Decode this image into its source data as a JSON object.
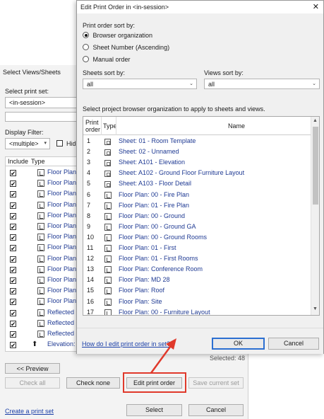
{
  "bg": {
    "title": "Select Views/Sheets",
    "select_print_set_label": "Select print set:",
    "print_set_value": "<in-session>",
    "display_filter_label": "Display Filter:",
    "display_filter_value": "<multiple>",
    "hide_label": "Hid",
    "col_include": "Include",
    "col_type": "Type",
    "rows": [
      {
        "label": "Floor Plan:"
      },
      {
        "label": "Floor Plan:"
      },
      {
        "label": "Floor Plan:"
      },
      {
        "label": "Floor Plan:"
      },
      {
        "label": "Floor Plan:"
      },
      {
        "label": "Floor Plan:"
      },
      {
        "label": "Floor Plan:"
      },
      {
        "label": "Floor Plan:"
      },
      {
        "label": "Floor Plan:"
      },
      {
        "label": "Floor Plan:"
      },
      {
        "label": "Floor Plan:"
      },
      {
        "label": "Floor Plan:"
      },
      {
        "label": "Floor Plan:"
      },
      {
        "label": "Reflected C"
      },
      {
        "label": "Reflected C"
      },
      {
        "label": "Reflected C"
      },
      {
        "label": "Elevation: E"
      }
    ],
    "selected_count": "Selected: 48",
    "preview_btn": "<< Preview",
    "check_all_btn": "Check all",
    "check_none_btn": "Check none",
    "edit_print_order_btn": "Edit print order",
    "save_current_set_btn": "Save current set",
    "create_print_set_link": "Create a print set",
    "select_btn": "Select",
    "cancel_btn": "Cancel"
  },
  "dialog": {
    "title": "Edit Print Order in <in-session>",
    "close_glyph": "✕",
    "sort_by_label": "Print order sort by:",
    "radio_browser": "Browser organization",
    "radio_sheet_number": "Sheet Number (Ascending)",
    "radio_manual": "Manual order",
    "sheets_sort_label": "Sheets sort by:",
    "sheets_sort_value": "all",
    "views_sort_label": "Views sort by:",
    "views_sort_value": "all",
    "instructions": "Select project browser organization to apply to sheets and views.",
    "col_print_order_1": "Print",
    "col_print_order_2": "order",
    "col_type": "Type",
    "col_name": "Name",
    "rows": [
      {
        "n": "1",
        "kind": "sheet",
        "name": "Sheet: 01 - Room Template"
      },
      {
        "n": "2",
        "kind": "sheet",
        "name": "Sheet: 02 - Unnamed"
      },
      {
        "n": "3",
        "kind": "sheet",
        "name": "Sheet: A101 - Elevation"
      },
      {
        "n": "4",
        "kind": "sheet",
        "name": "Sheet: A102 - Ground Floor Furniture Layout"
      },
      {
        "n": "5",
        "kind": "sheet",
        "name": "Sheet: A103 - Floor Detail"
      },
      {
        "n": "6",
        "kind": "plan",
        "name": "Floor Plan: 00 - Fire Plan"
      },
      {
        "n": "7",
        "kind": "plan",
        "name": "Floor Plan: 01 - Fire Plan"
      },
      {
        "n": "8",
        "kind": "plan",
        "name": "Floor Plan: 00 - Ground"
      },
      {
        "n": "9",
        "kind": "plan",
        "name": "Floor Plan: 00 - Ground GA"
      },
      {
        "n": "10",
        "kind": "plan",
        "name": "Floor Plan: 00 - Ground Rooms"
      },
      {
        "n": "11",
        "kind": "plan",
        "name": "Floor Plan: 01 - First"
      },
      {
        "n": "12",
        "kind": "plan",
        "name": "Floor Plan: 01 - First Rooms"
      },
      {
        "n": "13",
        "kind": "plan",
        "name": "Floor Plan: Conference Room"
      },
      {
        "n": "14",
        "kind": "plan",
        "name": "Floor Plan: MD 28"
      },
      {
        "n": "15",
        "kind": "plan",
        "name": "Floor Plan: Roof"
      },
      {
        "n": "16",
        "kind": "plan",
        "name": "Floor Plan: Site"
      },
      {
        "n": "17",
        "kind": "plan",
        "name": "Floor Plan: 00 - Furniture Layout"
      }
    ],
    "help_link": "How do I edit print order in set?",
    "ok_btn": "OK",
    "cancel_btn": "Cancel"
  },
  "colors": {
    "highlight": "#e0392b",
    "link": "#1a3fa8"
  }
}
